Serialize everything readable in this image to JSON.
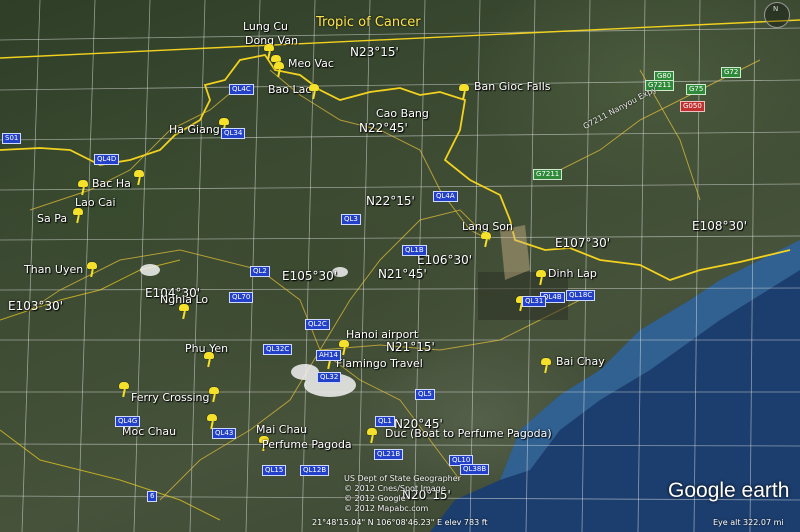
{
  "tropic": "Tropic of Cancer",
  "compass": "N",
  "logo": "Google earth",
  "grid": {
    "lat_23_15": "N23°15'",
    "lat_22_45": "N22°45'",
    "lat_22_15": "N22°15'",
    "lat_21_45": "N21°45'",
    "lat_21_15": "N21°15'",
    "lat_20_45": "N20°45'",
    "lat_20_15": "N20°15'",
    "lon_103_30": "E103°30'",
    "lon_104_30": "E104°30'",
    "lon_105_30": "E105°30'",
    "lon_106_30": "E106°30'",
    "lon_107_30": "E107°30'",
    "lon_108_30": "E108°30'"
  },
  "places": {
    "lung_cu": "Lung Cu",
    "dong_van": "Dong Van",
    "meo_vac": "Meo Vac",
    "bao_lac": "Bao Lac",
    "ban_gioc": "Ban Gioc Falls",
    "cao_bang": "Cao Bang",
    "ha_giang": "Ha Giang",
    "bac_ha": "Bac Ha",
    "lao_cai": "Lao Cai",
    "sa_pa": "Sa Pa",
    "than_uyen": "Than Uyen",
    "nghia_lo": "Nghia Lo",
    "phu_yen": "Phu Yen",
    "ferry_crossing": "Ferry Crossing",
    "moc_chau": "Moc Chau",
    "mai_chau": "Mai Chau",
    "perfume_pagoda": "Perfume Pagoda",
    "hanoi_airport": "Hanoi airport",
    "flamingo_travel": "Flamingo Travel",
    "duc_boat": "Duc (Boat to Perfume Pagoda)",
    "lang_son": "Lang Son",
    "dinh_lap": "Dinh Lap",
    "bai_chay": "Bai Chay"
  },
  "roads": {
    "ql4c": "QL4C",
    "ql34": "QL34",
    "ql4d": "QL4D",
    "s01": "S01",
    "ql4a": "QL4A",
    "ql3": "QL3",
    "ql1b": "QL1B",
    "ql2": "QL2",
    "ql70": "QL70",
    "ql2c": "QL2C",
    "ql32c": "QL32C",
    "ql32": "QL32",
    "ql5": "QL5",
    "ql1": "QL1",
    "ql4g": "QL4G",
    "ql43": "QL43",
    "ql21b": "QL21B",
    "ql15": "QL15",
    "ql12b": "QL12B",
    "ql10": "QL10",
    "ql38b": "QL38B",
    "r6": "6",
    "ql4b": "QL4B",
    "ql18c": "QL18C",
    "ql31": "QL31",
    "ah14": "AH14",
    "g80": "G80",
    "g72": "G72",
    "g75": "G75",
    "g7211": "G7211",
    "g7211b": "G7211",
    "g050": "G050",
    "nanyou": "G7211 Nanyou Expy"
  },
  "credits": {
    "line1": "US Dept of State Geographer",
    "line2": "© 2012 Cnes/Spot Image",
    "line3": "© 2012 Google",
    "line4": "© 2012 Mapabc.com"
  },
  "status": {
    "coords": "21°48'15.04\" N 106°08'46.23\" E  elev  783 ft",
    "eye_alt": "Eye alt  322.07 mi"
  }
}
